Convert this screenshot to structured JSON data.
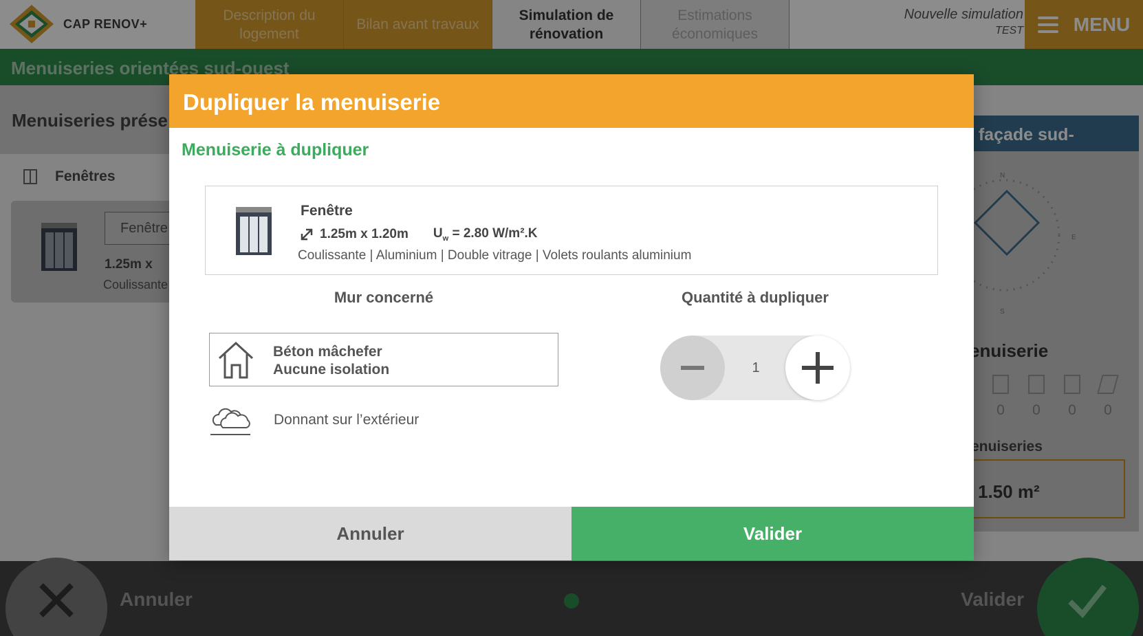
{
  "app": {
    "logo_text": "CAP RENOV+",
    "steps": [
      {
        "label": "Description du logement",
        "state": "done"
      },
      {
        "label": "Bilan avant travaux",
        "state": "done"
      },
      {
        "label": "Simulation de rénovation",
        "state": "active"
      },
      {
        "label": "Estimations économiques",
        "state": "disabled"
      }
    ],
    "simulation_title": "Nouvelle simulation",
    "simulation_name": "TEST",
    "menu_label": "MENU"
  },
  "page": {
    "section_title": "Menuiseries orientées sud-ouest",
    "left_panel_title": "Menuiseries prése",
    "category_label": "Fenêtres",
    "card_input_value": "Fenêtre",
    "card_size": "1.25m x",
    "card_type": "Coulissante",
    "right_panel_title": "s façade sud-",
    "compass": {
      "n": "N",
      "e": "E",
      "s": "S"
    },
    "right_menuiserie_label": "enuiserie",
    "counts": [
      "0",
      "0",
      "0",
      "0"
    ],
    "right_menuiseries_label": "enuiseries",
    "area_value": "1.50 m²"
  },
  "modal": {
    "title": "Dupliquer la menuiserie",
    "subtitle": "Menuiserie à dupliquer",
    "item": {
      "name": "Fenêtre",
      "dimensions": "1.25m x 1.20m",
      "uw_label": "U",
      "uw_sub": "w",
      "uw_value": " = 2.80 W/m².K",
      "description": "Coulissante | Aluminium | Double vitrage | Volets roulants aluminium"
    },
    "wall_title": "Mur concerné",
    "wall_line1": "Béton mâchefer",
    "wall_line2": "Aucune isolation",
    "outside_label": "Donnant sur l’extérieur",
    "quantity_title": "Quantité à dupliquer",
    "quantity_value": "1",
    "cancel_label": "Annuler",
    "validate_label": "Valider"
  },
  "footer": {
    "cancel_label": "Annuler",
    "validate_label": "Valider"
  },
  "colors": {
    "orange": "#f2a42c",
    "green": "#46b068",
    "dark_green": "#2e8d4e",
    "blue": "#3c6d8e"
  }
}
